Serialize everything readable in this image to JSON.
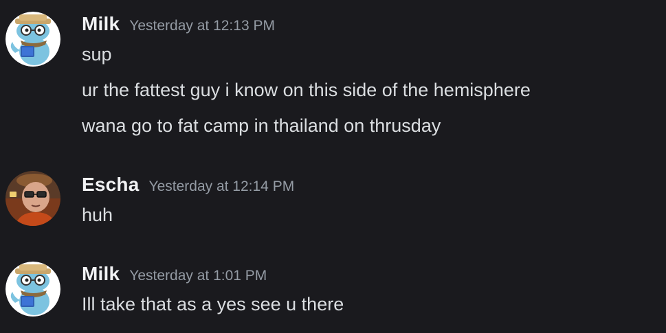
{
  "messages": [
    {
      "author": "Milk",
      "timestamp": "Yesterday at 12:13 PM",
      "avatar": "milk-cartoon-avatar-icon",
      "lines": [
        "sup",
        "ur the fattest guy i know on this side of the hemisphere",
        "wana go to fat camp in thailand on thrusday"
      ]
    },
    {
      "author": "Escha",
      "timestamp": "Yesterday at 12:14 PM",
      "avatar": "escha-photo-avatar-icon",
      "lines": [
        "huh"
      ]
    },
    {
      "author": "Milk",
      "timestamp": "Yesterday at 1:01 PM",
      "avatar": "milk-cartoon-avatar-icon",
      "lines": [
        "Ill take that as a yes see u there"
      ]
    }
  ],
  "colors": {
    "background": "#1a1a1e",
    "username": "#f2f3f5",
    "timestamp": "#949ba4",
    "message_text": "#dbdee1"
  }
}
